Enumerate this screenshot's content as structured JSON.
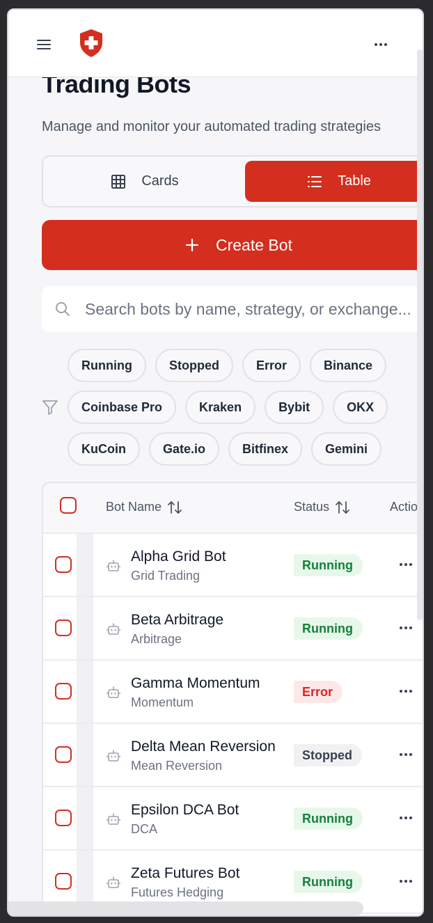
{
  "header": {
    "menu_icon": "menu-icon",
    "logo_icon": "shield-cross-icon",
    "more_icon": "more-horizontal-icon",
    "brand_color": "#d42e1f"
  },
  "page": {
    "title": "Trading Bots",
    "subtitle": "Manage and monitor your automated trading strategies"
  },
  "view_toggle": {
    "cards_label": "Cards",
    "table_label": "Table",
    "selected": "Table"
  },
  "create_button": {
    "label": "Create Bot"
  },
  "search": {
    "placeholder": "Search bots by name, strategy, or exchange..."
  },
  "filters": {
    "rows": [
      [
        "Running",
        "Stopped",
        "Error",
        "Binance"
      ],
      [
        "Coinbase Pro",
        "Kraken",
        "Bybit",
        "OKX"
      ],
      [
        "KuCoin",
        "Gate.io",
        "Bitfinex",
        "Gemini"
      ]
    ]
  },
  "table": {
    "columns": {
      "name": "Bot Name",
      "status": "Status",
      "actions": "Actions"
    },
    "rows": [
      {
        "name": "Alpha Grid Bot",
        "strategy": "Grid Trading",
        "status": "Running"
      },
      {
        "name": "Beta Arbitrage",
        "strategy": "Arbitrage",
        "status": "Running"
      },
      {
        "name": "Gamma Momentum",
        "strategy": "Momentum",
        "status": "Error"
      },
      {
        "name": "Delta Mean Reversion",
        "strategy": "Mean Reversion",
        "status": "Stopped"
      },
      {
        "name": "Epsilon DCA Bot",
        "strategy": "DCA",
        "status": "Running"
      },
      {
        "name": "Zeta Futures Bot",
        "strategy": "Futures Hedging",
        "status": "Running"
      }
    ],
    "status_colors": {
      "Running": {
        "bg": "#e7f8ea",
        "fg": "#15803d"
      },
      "Error": {
        "bg": "#fde8e8",
        "fg": "#dc2626"
      },
      "Stopped": {
        "bg": "#f1f1f4",
        "fg": "#374151"
      }
    }
  }
}
